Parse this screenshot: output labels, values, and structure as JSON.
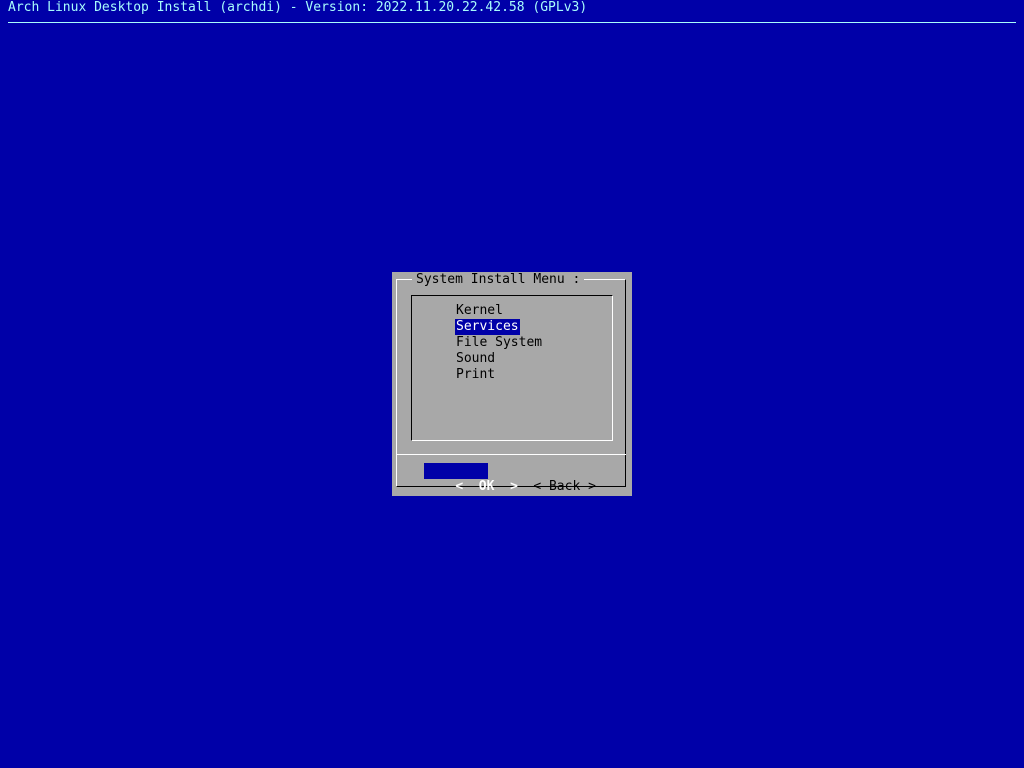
{
  "backtitle": "Arch Linux Desktop Install (archdi) - Version: 2022.11.20.22.42.58 (GPLv3)",
  "dialog": {
    "title": "System Install Menu :",
    "menu": {
      "items": [
        {
          "label": "Kernel",
          "selected": false
        },
        {
          "label": "Services",
          "selected": true
        },
        {
          "label": "File System",
          "selected": false
        },
        {
          "label": "Sound",
          "selected": false
        },
        {
          "label": "Print",
          "selected": false
        }
      ]
    },
    "buttons": {
      "ok": {
        "left": "<",
        "label": "OK",
        "right": ">",
        "focused": true
      },
      "back": {
        "left": "<",
        "label": "Back",
        "right": ">",
        "focused": false
      }
    }
  },
  "colors": {
    "background": "#0000a8",
    "dialog_background": "#a8a8a8",
    "highlight": "#0000a8",
    "backtitle": "#a8fcfc"
  }
}
